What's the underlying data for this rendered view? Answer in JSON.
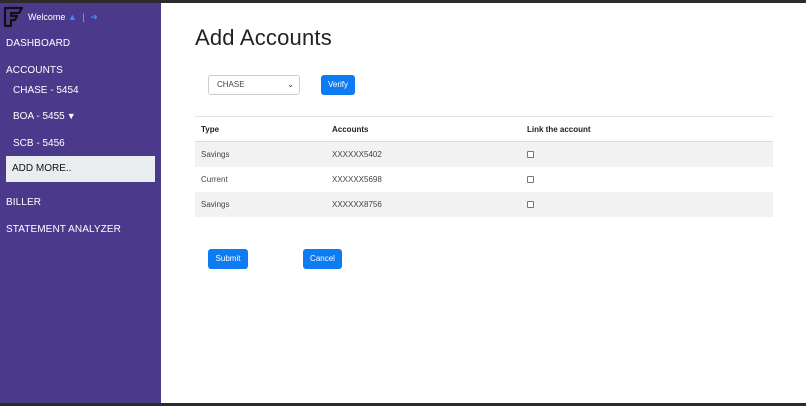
{
  "sidebar": {
    "welcome": "Welcome",
    "separator": "|",
    "items": {
      "dashboard": "DASHBOARD",
      "accounts": "ACCOUNTS",
      "chase": "CHASE - 5454",
      "boa": "BOA - 5455",
      "scb": "SCB - 5456",
      "add_more": "ADD MORE..",
      "biller": "BILLER",
      "statement_analyzer": "STATEMENT ANALYZER"
    },
    "colors": {
      "background": "#4b3a8c",
      "active_item": "#eaedf0"
    }
  },
  "main": {
    "title": "Add Accounts",
    "bank_select": {
      "value": "CHASE"
    },
    "verify_label": "Verify",
    "table": {
      "headers": [
        "Type",
        "Accounts",
        "Link the account"
      ],
      "rows": [
        {
          "type": "Savings",
          "account": "XXXXXX5402",
          "linked": false
        },
        {
          "type": "Current",
          "account": "XXXXXX5698",
          "linked": false
        },
        {
          "type": "Savings",
          "account": "XXXXXX8756",
          "linked": false
        }
      ]
    },
    "submit_label": "Submit",
    "cancel_label": "Cancel",
    "colors": {
      "primary": "#0d7bf2"
    }
  }
}
